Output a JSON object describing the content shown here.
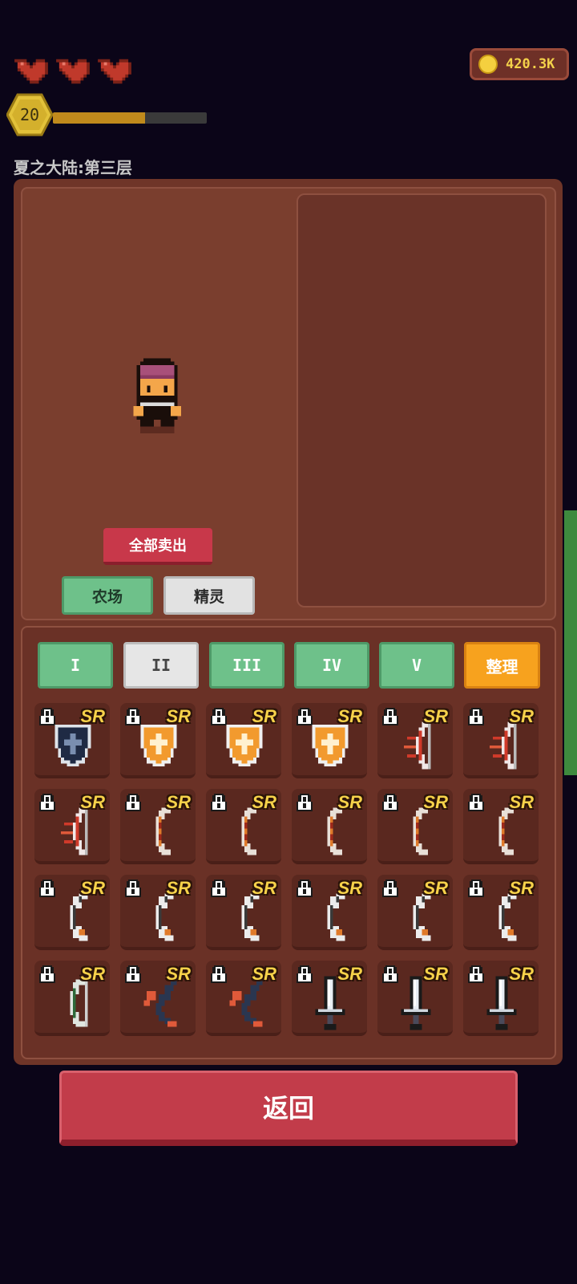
{
  "hud": {
    "hearts": 3,
    "gold": "420.3K",
    "level": "20",
    "xp_fraction": 0.6,
    "location": "夏之大陆:第三层"
  },
  "actions": {
    "sell_all": "全部卖出",
    "farm": "农场",
    "elf": "精灵",
    "sort": "整理",
    "back": "返回"
  },
  "tiers": [
    "I",
    "II",
    "III",
    "IV",
    "V"
  ],
  "active_tier": "II",
  "inventory": [
    {
      "type": "shield-dark",
      "rarity": "SR"
    },
    {
      "type": "shield-orange",
      "rarity": "SR"
    },
    {
      "type": "shield-orange",
      "rarity": "SR"
    },
    {
      "type": "shield-orange",
      "rarity": "SR"
    },
    {
      "type": "bow-spike",
      "rarity": "SR"
    },
    {
      "type": "bow-spike",
      "rarity": "SR"
    },
    {
      "type": "bow-spike",
      "rarity": "SR"
    },
    {
      "type": "bow-orange",
      "rarity": "SR"
    },
    {
      "type": "bow-orange",
      "rarity": "SR"
    },
    {
      "type": "bow-orange",
      "rarity": "SR"
    },
    {
      "type": "bow-orange",
      "rarity": "SR"
    },
    {
      "type": "bow-orange",
      "rarity": "SR"
    },
    {
      "type": "bow-silver",
      "rarity": "SR"
    },
    {
      "type": "bow-silver",
      "rarity": "SR"
    },
    {
      "type": "bow-silver",
      "rarity": "SR"
    },
    {
      "type": "bow-silver",
      "rarity": "SR"
    },
    {
      "type": "bow-silver",
      "rarity": "SR"
    },
    {
      "type": "bow-silver",
      "rarity": "SR"
    },
    {
      "type": "bow-green",
      "rarity": "SR"
    },
    {
      "type": "bow-dark",
      "rarity": "SR"
    },
    {
      "type": "bow-dark",
      "rarity": "SR"
    },
    {
      "type": "sword",
      "rarity": "SR"
    },
    {
      "type": "sword",
      "rarity": "SR"
    },
    {
      "type": "sword",
      "rarity": "SR"
    }
  ]
}
